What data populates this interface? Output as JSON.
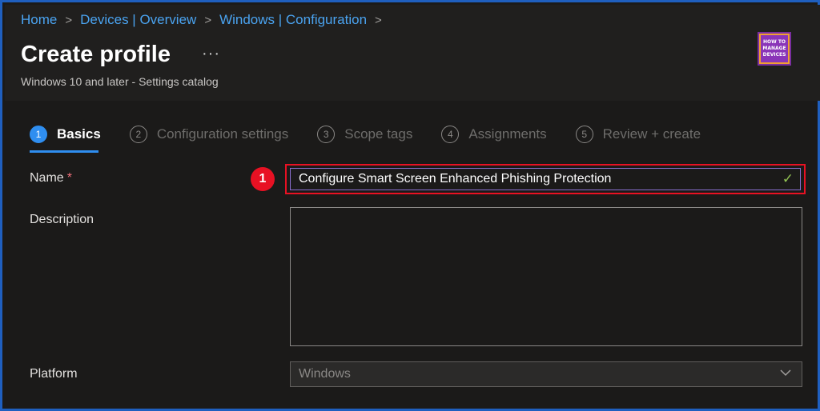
{
  "breadcrumb": {
    "items": [
      "Home",
      "Devices | Overview",
      "Windows | Configuration"
    ],
    "separator": ">"
  },
  "header": {
    "title": "Create profile",
    "more": "···",
    "subtitle": "Windows 10 and later - Settings catalog",
    "logo": {
      "line1": "HOW TO",
      "line2": "MANAGE",
      "line3": "DEVICES"
    }
  },
  "steps": [
    {
      "num": "1",
      "label": "Basics",
      "active": true
    },
    {
      "num": "2",
      "label": "Configuration settings",
      "active": false
    },
    {
      "num": "3",
      "label": "Scope tags",
      "active": false
    },
    {
      "num": "4",
      "label": "Assignments",
      "active": false
    },
    {
      "num": "5",
      "label": "Review + create",
      "active": false
    }
  ],
  "form": {
    "name_label": "Name",
    "required_mark": "*",
    "name_value": "Configure Smart Screen Enhanced Phishing Protection",
    "name_check": "✓",
    "description_label": "Description",
    "description_value": "",
    "platform_label": "Platform",
    "platform_value": "Windows"
  },
  "annotation": {
    "badge": "1"
  },
  "colors": {
    "accent": "#2f8ef0",
    "link": "#4aa3f0",
    "highlight": "#e81123",
    "valid": "#92c353"
  }
}
